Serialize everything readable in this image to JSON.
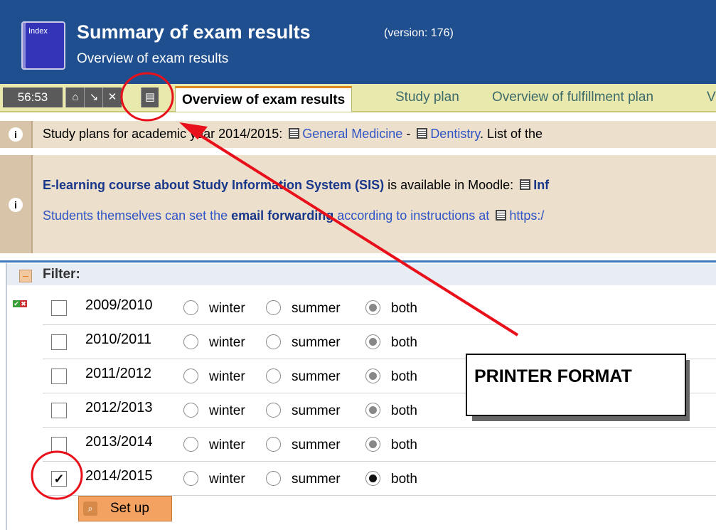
{
  "header": {
    "icon_text": "Index",
    "title": "Summary of exam results",
    "version": "(version: 176)",
    "subtitle": "Overview of exam results"
  },
  "toolbar": {
    "timer": "56:53",
    "active_tab": "Overview of exam results",
    "tabs": [
      "Study plan",
      "Overview of fulfillment plan",
      "V"
    ]
  },
  "info1": {
    "prefix": "Study plans for academic year 2014/2015:",
    "link1": "General Medicine",
    "sep": " - ",
    "link2": "Dentistry",
    "suffix": ". List of the"
  },
  "info2": {
    "line1_link": "E-learning course about Study Information System (SIS)",
    "line1_text": " is available in Moodle: ",
    "line1_tail": "Inf",
    "line2_pre": "Students themselves can set the ",
    "line2_bold": "email forwarding",
    "line2_text": " according to instructions at ",
    "line2_tail": "https:/"
  },
  "filter": {
    "label": "Filter:",
    "collapse": "–",
    "radio_labels": {
      "winter": "winter",
      "summer": "summer",
      "both": "both"
    },
    "rows": [
      {
        "year": "2009/2010",
        "checked": false,
        "checkmark": "",
        "selected": "both"
      },
      {
        "year": "2010/2011",
        "checked": false,
        "checkmark": "",
        "selected": "both"
      },
      {
        "year": "2011/2012",
        "checked": false,
        "checkmark": "",
        "selected": "both"
      },
      {
        "year": "2012/2013",
        "checked": false,
        "checkmark": "",
        "selected": "both"
      },
      {
        "year": "2013/2014",
        "checked": false,
        "checkmark": "",
        "selected": "both"
      },
      {
        "year": "2014/2015",
        "checked": true,
        "checkmark": "✓",
        "selected": "both"
      }
    ],
    "setup_label": "Set up"
  },
  "annotation": {
    "callout": "PRINTER FORMAT",
    "color": "#e8101a"
  }
}
